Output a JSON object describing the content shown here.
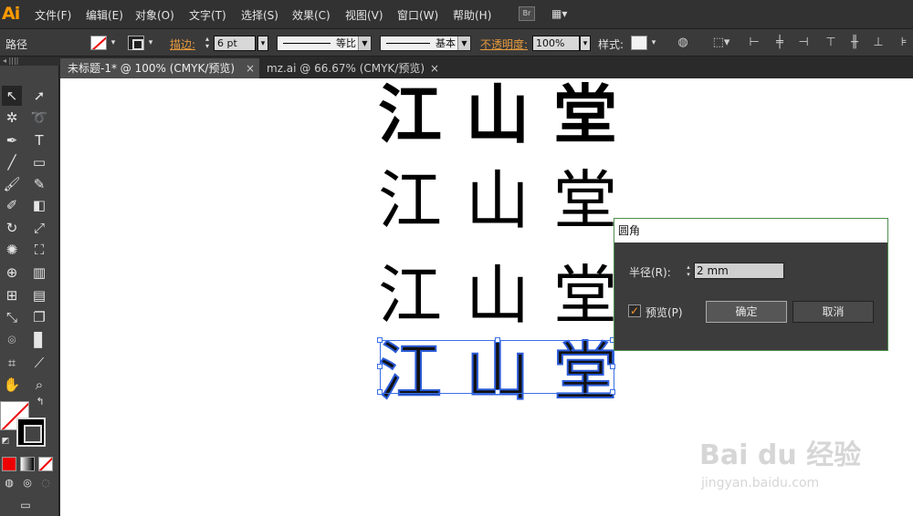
{
  "app": {
    "logo": "Ai"
  },
  "menubar": {
    "items": [
      "文件(F)",
      "编辑(E)",
      "对象(O)",
      "文字(T)",
      "选择(S)",
      "效果(C)",
      "视图(V)",
      "窗口(W)",
      "帮助(H)"
    ],
    "bridge_label": "Br",
    "workspace_icon": "grid-layout-icon"
  },
  "controlbar": {
    "selection_label": "路径",
    "stroke_label": "描边:",
    "stroke_weight": "6 pt",
    "profile_label": "等比",
    "brush_label": "基本",
    "opacity_label": "不透明度:",
    "opacity_value": "100%",
    "style_label": "样式:"
  },
  "tabs": [
    {
      "label": "未标题-1* @ 100% (CMYK/预览)",
      "close": "×",
      "active": true
    },
    {
      "label": "mz.ai @ 66.67% (CMYK/预览)",
      "close": "×",
      "active": false
    }
  ],
  "tools": {
    "panel_grip": "◂  ||||",
    "icons": [
      "selection-icon",
      "direct-selection-icon",
      "magic-wand-icon",
      "lasso-icon",
      "pen-icon",
      "type-icon",
      "line-icon",
      "rectangle-icon",
      "paintbrush-icon",
      "pencil-icon",
      "blob-brush-icon",
      "eraser-icon",
      "rotate-icon",
      "scale-icon",
      "warp-icon",
      "free-transform-icon",
      "shape-builder-icon",
      "perspective-icon",
      "mesh-icon",
      "gradient-icon",
      "eyedropper-icon",
      "blend-icon",
      "symbol-sprayer-icon",
      "graph-icon",
      "artboard-icon",
      "slice-icon",
      "hand-icon",
      "zoom-icon"
    ]
  },
  "canvas": {
    "rows": [
      "江山堂",
      "江山堂",
      "江山堂",
      "江山堂"
    ],
    "watermark_brand": "Bai du 经验",
    "watermark_url": "jingyan.baidu.com"
  },
  "dialog": {
    "title": "圆角",
    "radius_label": "半径(R):",
    "radius_value": "2 mm",
    "preview_label": "预览(P)",
    "preview_checked": "✓",
    "ok_label": "确定",
    "cancel_label": "取消"
  },
  "colors": {
    "accent": "#ff9a00",
    "selection": "#3b6fe6",
    "dialog_border": "#4f8f4f"
  }
}
